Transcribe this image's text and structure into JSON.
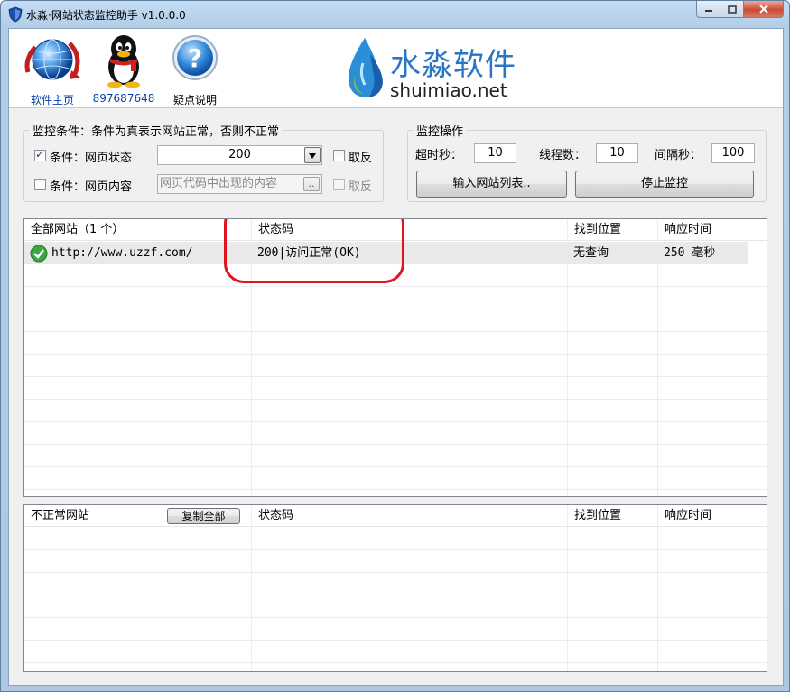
{
  "window": {
    "title": "水淼·网站状态监控助手 v1.0.0.0"
  },
  "banner": {
    "home_label": "软件主页",
    "qq_label": "897687648",
    "help_label": "疑点说明",
    "logo_cn": "水淼软件",
    "logo_en": "shuimiao.net"
  },
  "conditions": {
    "title": "监控条件：条件为真表示网站正常，否则不正常",
    "status_label": "条件：网页状态",
    "status_checked": true,
    "status_value": "200",
    "status_invert_label": "取反",
    "content_label": "条件：网页内容",
    "content_checked": false,
    "content_placeholder": "网页代码中出现的内容",
    "content_btn": "..",
    "content_invert_label": "取反"
  },
  "operations": {
    "title": "监控操作",
    "timeout_label": "超时秒：",
    "timeout_value": "10",
    "threads_label": "线程数：",
    "threads_value": "10",
    "interval_label": "间隔秒：",
    "interval_value": "100",
    "import_button": "输入网站列表..",
    "stop_button": "停止监控"
  },
  "all_sites": {
    "columns": [
      "全部网站（1 个）",
      "状态码",
      "找到位置",
      "响应时间"
    ],
    "rows": [
      {
        "url": "http://www.uzzf.com/",
        "status": "200|访问正常(OK)",
        "location": "无查询",
        "time": "250 毫秒",
        "ok": true
      }
    ]
  },
  "bad_sites": {
    "columns": [
      "不正常网站",
      "状态码",
      "找到位置",
      "响应时间"
    ],
    "copy_button": "复制全部",
    "rows": []
  },
  "colors": {
    "annotation": "#e0141e",
    "logo_blue": "#2a76c4"
  }
}
